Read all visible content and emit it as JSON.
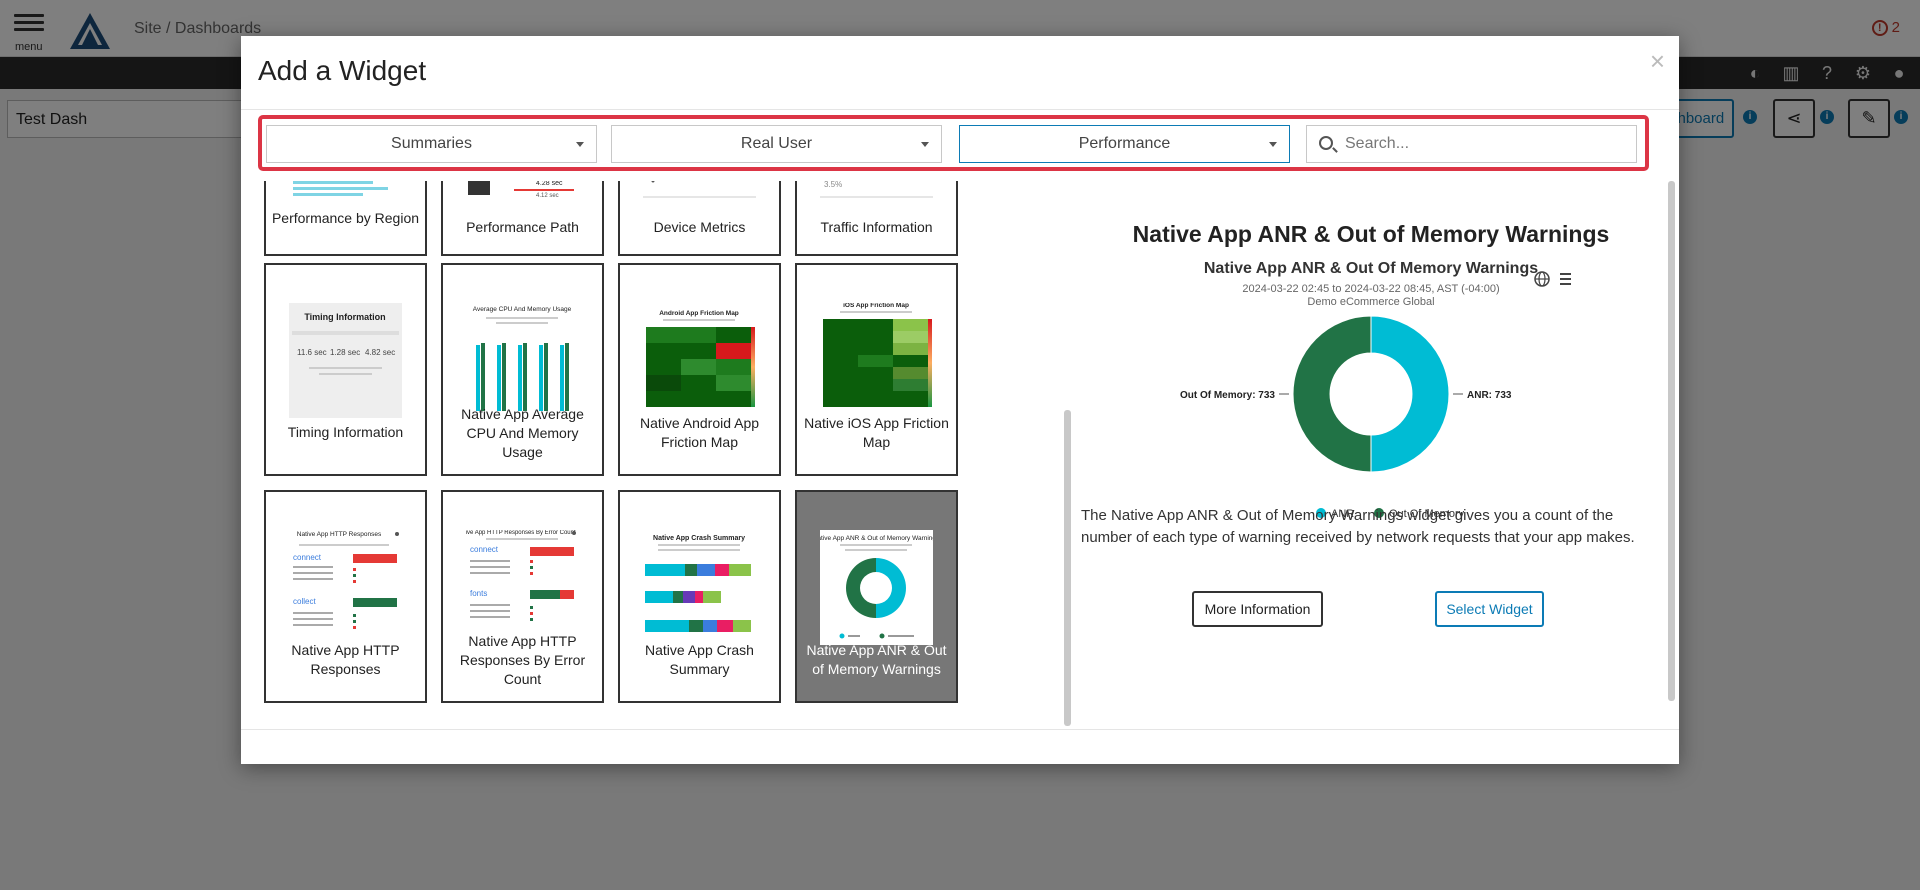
{
  "app": {
    "menu_label": "menu",
    "breadcrumb": "Site / Dashboards",
    "alert_count": "2",
    "dashboard_name": "Test Dash",
    "dashboard_button_label": "shboard"
  },
  "modal": {
    "title": "Add a Widget",
    "close_label": "×",
    "filters": {
      "category": "Summaries",
      "monitoring": "Real User",
      "metric": "Performance",
      "search_placeholder": "Search..."
    },
    "widgets": [
      {
        "label": "Performance by Region",
        "selected": false
      },
      {
        "label": "Performance Path",
        "selected": false
      },
      {
        "label": "Device Metrics",
        "selected": false
      },
      {
        "label": "Traffic Information",
        "selected": false
      },
      {
        "label": "Timing Information",
        "selected": false
      },
      {
        "label": "Native App Average CPU And Memory Usage",
        "selected": false
      },
      {
        "label": "Native Android App Friction Map",
        "selected": false
      },
      {
        "label": "Native iOS App Friction Map",
        "selected": false
      },
      {
        "label": "Native App HTTP Responses",
        "selected": false
      },
      {
        "label": "Native App HTTP Responses By Error Count",
        "selected": false
      },
      {
        "label": "Native App Crash Summary",
        "selected": false
      },
      {
        "label": "Native App ANR & Out of Memory Warnings",
        "selected": true
      }
    ],
    "detail": {
      "title": "Native App ANR & Out of Memory Warnings",
      "description": "The Native App ANR & Out of Memory Warnings widget gives you a count of the number of each type of warning received by network requests that your app makes.",
      "more_info_label": "More Information",
      "select_label": "Select Widget"
    }
  },
  "chart_data": {
    "type": "pie",
    "title": "Native App ANR & Out Of Memory Warnings",
    "subtitle": "2024-03-22 02:45 to 2024-03-22 08:45, AST (-04:00)",
    "subtitle2": "Demo eCommerce Global",
    "categories": [
      "ANR",
      "Out Of Memory"
    ],
    "values": [
      733,
      733
    ],
    "data_labels": [
      "ANR: 733",
      "Out Of Memory: 733"
    ],
    "colors": [
      "#00bcd4",
      "#217346"
    ],
    "legend": "bottom",
    "donut": true
  }
}
